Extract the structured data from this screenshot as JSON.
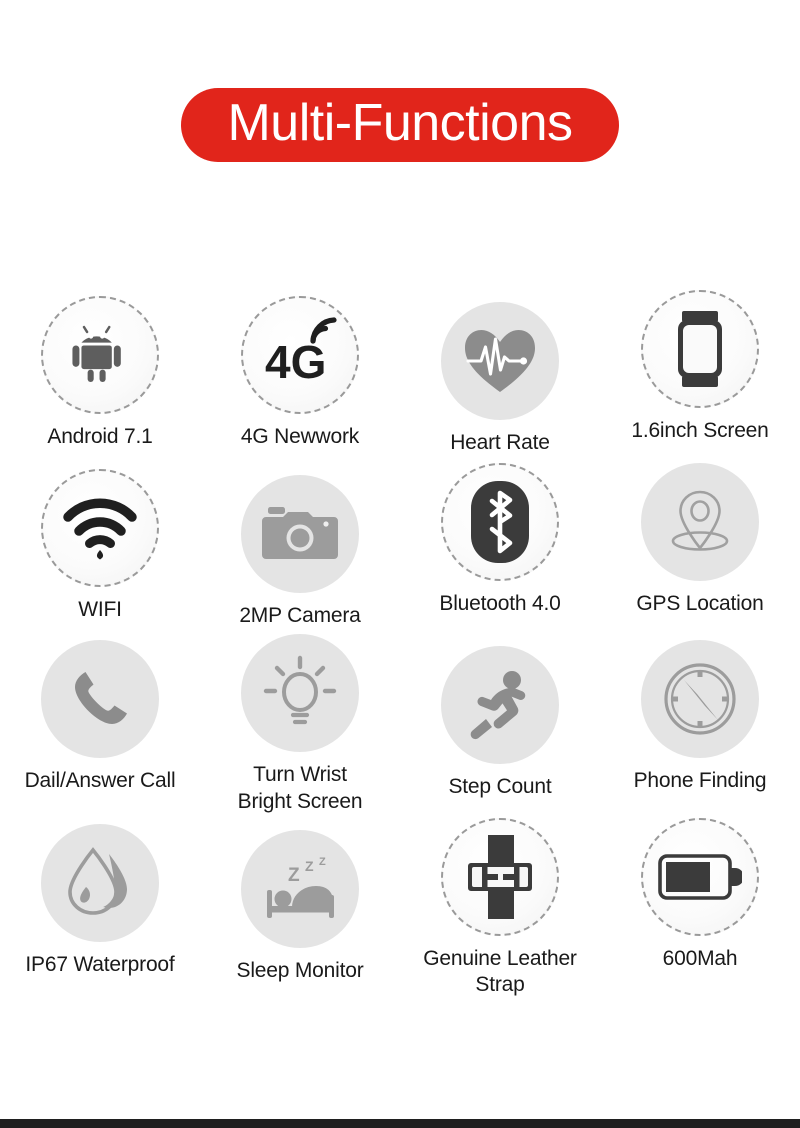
{
  "banner": {
    "title": "Multi-Functions",
    "bg_color": "#E1251B",
    "text_color": "#FFFFFF"
  },
  "theme": {
    "circle_fill": "#E4E4E4",
    "icon_gray": "#8C8C8C",
    "icon_dark": "#3B3B3B",
    "label_color": "#1A1A1A",
    "dash_color": "#9A9A9A",
    "bottom_bar_color": "#1F1F1F"
  },
  "features": [
    [
      {
        "label": "Android 7.1",
        "icon": "android-icon",
        "style": "dashed"
      },
      {
        "label": "4G Newwork",
        "icon": "4g-signal-icon",
        "style": "dashed"
      },
      {
        "label": "Heart Rate",
        "icon": "heart-pulse-icon",
        "style": "solid"
      },
      {
        "label": "1.6inch Screen",
        "icon": "smartwatch-icon",
        "style": "dashed"
      }
    ],
    [
      {
        "label": "WIFI",
        "icon": "wifi-icon",
        "style": "dashed"
      },
      {
        "label": "2MP  Camera",
        "icon": "camera-icon",
        "style": "solid"
      },
      {
        "label": "Bluetooth 4.0",
        "icon": "bluetooth-icon",
        "style": "dashed"
      },
      {
        "label": "GPS Location",
        "icon": "map-pin-icon",
        "style": "solid"
      }
    ],
    [
      {
        "label": "Dail/Answer Call",
        "icon": "phone-handset-icon",
        "style": "solid"
      },
      {
        "label": "Turn Wrist\nBright Screen",
        "icon": "lightbulb-icon",
        "style": "solid"
      },
      {
        "label": "Step Count",
        "icon": "running-person-icon",
        "style": "solid"
      },
      {
        "label": "Phone Finding",
        "icon": "compass-icon",
        "style": "solid"
      }
    ],
    [
      {
        "label": "IP67 Waterproof",
        "icon": "water-drop-icon",
        "style": "solid"
      },
      {
        "label": "Sleep Monitor",
        "icon": "sleep-bed-icon",
        "style": "solid"
      },
      {
        "label": "Genuine Leather\nStrap",
        "icon": "watch-strap-icon",
        "style": "dashed"
      },
      {
        "label": "600Mah",
        "icon": "battery-icon",
        "style": "dashed"
      }
    ]
  ]
}
